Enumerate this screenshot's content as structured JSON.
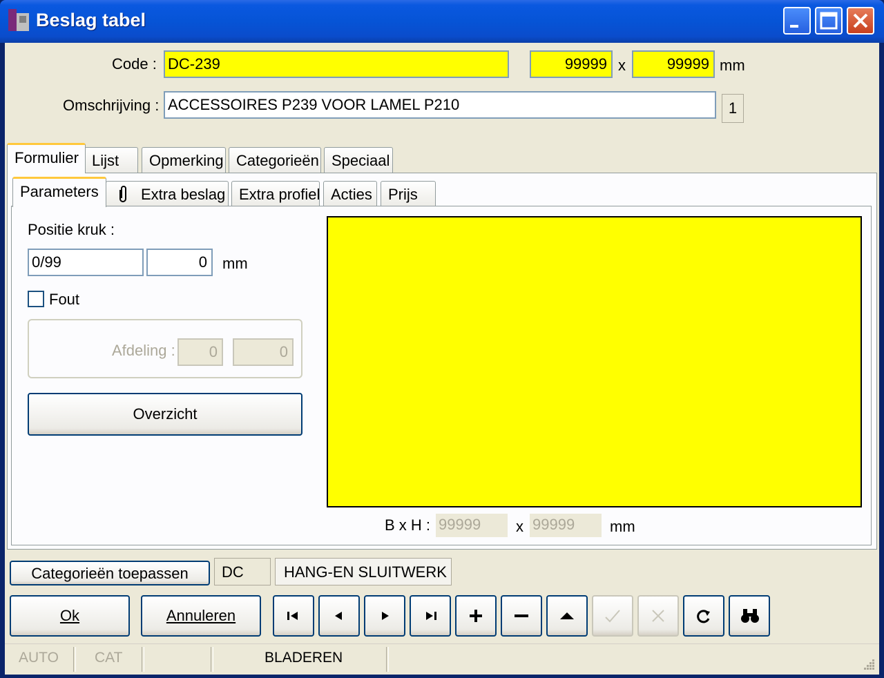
{
  "window": {
    "title": "Beslag tabel"
  },
  "header": {
    "code_label": "Code :",
    "code_value": "DC-239",
    "width_value": "99999",
    "times": "x",
    "height_value": "99999",
    "unit": "mm",
    "omschrijving_label": "Omschrijving :",
    "omschrijving_value": "ACCESSOIRES P239 VOOR LAMEL P210",
    "count_badge": "1"
  },
  "main_tabs": [
    "Formulier",
    "Lijst",
    "Opmerking",
    "Categorieën",
    "Speciaal"
  ],
  "sub_tabs": [
    "Parameters",
    "Extra beslag",
    "Extra profiel",
    "Acties",
    "Prijs"
  ],
  "parameters": {
    "positie_label": "Positie kruk :",
    "positie_value": "0/99",
    "positie_mm_value": "0",
    "mm": "mm",
    "fout_label": "Fout",
    "afdeling_label": "Afdeling :",
    "afdeling_value_1": "0",
    "afdeling_value_2": "0",
    "overzicht_button": "Overzicht"
  },
  "preview": {
    "bxh_label": "B x H :",
    "b_value": "99999",
    "times": "x",
    "h_value": "99999",
    "unit": "mm",
    "fill_color": "#ffff00"
  },
  "categories": {
    "apply_button": "Categorieën toepassen",
    "code": "DC",
    "name": "HANG-EN SLUITWERK"
  },
  "buttons": {
    "ok_label": "Ok",
    "cancel_label": "Annuleren"
  },
  "statusbar": {
    "auto": "AUTO",
    "cat": "CAT",
    "mode": "BLADEREN"
  }
}
